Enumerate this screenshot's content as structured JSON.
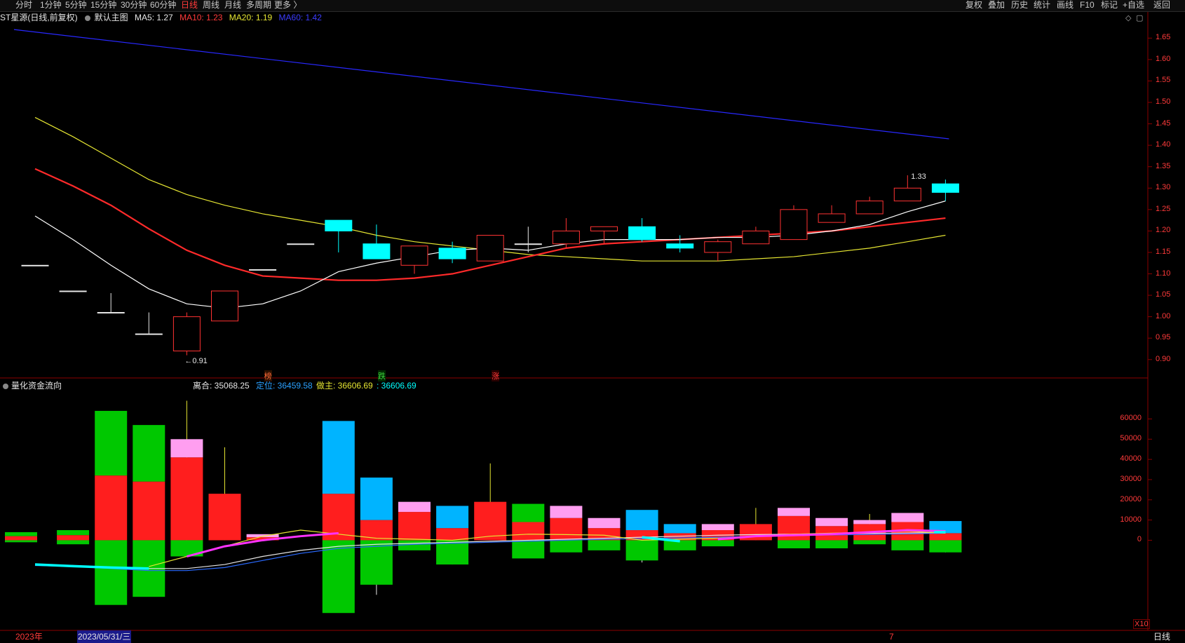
{
  "toolbar": {
    "left_items": [
      "分时",
      "1分钟",
      "5分钟",
      "15分钟",
      "30分钟",
      "60分钟",
      "日线",
      "周线",
      "月线",
      "多周期",
      "更多 〉"
    ],
    "active_index": 6,
    "right_items": [
      "复权",
      "叠加",
      "历史",
      "统计",
      "画线",
      "F10",
      "标记",
      "+自选",
      "返回"
    ]
  },
  "main_header": {
    "stock": "ST星源(日线,前复权)",
    "template": "默认主图",
    "ma5": "MA5: 1.27",
    "ma10": "MA10: 1.23",
    "ma20": "MA20: 1.19",
    "ma60": "MA60: 1.42"
  },
  "sub_header": {
    "indicator": "量化资金流向",
    "v1": "离合: 35068.25",
    "v2": "定位: 36459.58",
    "v3": "做主: 36606.69",
    "v4": ": 36606.69"
  },
  "annotations": {
    "low": "←0.91",
    "high": "1.33",
    "tag1": "榜",
    "tag2": "跌",
    "tag3": "涨"
  },
  "colors": {
    "up": "#ff3232",
    "down": "#00ffff",
    "ma5": "#ffffff",
    "ma10": "#ff2a2a",
    "ma20": "#e6e632",
    "ma60": "#2828ff",
    "axis": "#8b0000"
  },
  "chart_data": [
    {
      "type": "candlestick",
      "title": "ST星源(日线,前复权)",
      "y_ticks": [
        "1.65",
        "1.60",
        "1.55",
        "1.50",
        "1.45",
        "1.40",
        "1.35",
        "1.30",
        "1.25",
        "1.20",
        "1.15",
        "1.10",
        "1.05",
        "1.00",
        "0.95",
        "0.90"
      ],
      "ylim": [
        0.88,
        1.68
      ],
      "candles": [
        {
          "o": 1.12,
          "h": 1.12,
          "l": 1.12,
          "c": 1.12
        },
        {
          "o": 1.06,
          "h": 1.06,
          "l": 1.06,
          "c": 1.06
        },
        {
          "o": 1.01,
          "h": 1.055,
          "l": 1.01,
          "c": 1.01
        },
        {
          "o": 0.96,
          "h": 1.01,
          "l": 0.96,
          "c": 0.96
        },
        {
          "o": 0.92,
          "h": 1.01,
          "l": 0.91,
          "c": 1.0
        },
        {
          "o": 0.99,
          "h": 1.06,
          "l": 0.99,
          "c": 1.06
        },
        {
          "o": 1.11,
          "h": 1.11,
          "l": 1.11,
          "c": 1.11
        },
        {
          "o": 1.17,
          "h": 1.17,
          "l": 1.17,
          "c": 1.17
        },
        {
          "o": 1.225,
          "h": 1.225,
          "l": 1.15,
          "c": 1.2
        },
        {
          "o": 1.17,
          "h": 1.215,
          "l": 1.14,
          "c": 1.135
        },
        {
          "o": 1.12,
          "h": 1.165,
          "l": 1.1,
          "c": 1.165
        },
        {
          "o": 1.16,
          "h": 1.175,
          "l": 1.125,
          "c": 1.135
        },
        {
          "o": 1.13,
          "h": 1.19,
          "l": 1.13,
          "c": 1.19
        },
        {
          "o": 1.17,
          "h": 1.21,
          "l": 1.15,
          "c": 1.17
        },
        {
          "o": 1.17,
          "h": 1.23,
          "l": 1.16,
          "c": 1.2
        },
        {
          "o": 1.2,
          "h": 1.21,
          "l": 1.17,
          "c": 1.21
        },
        {
          "o": 1.21,
          "h": 1.23,
          "l": 1.175,
          "c": 1.18
        },
        {
          "o": 1.17,
          "h": 1.19,
          "l": 1.15,
          "c": 1.16
        },
        {
          "o": 1.15,
          "h": 1.18,
          "l": 1.13,
          "c": 1.175
        },
        {
          "o": 1.17,
          "h": 1.21,
          "l": 1.17,
          "c": 1.2
        },
        {
          "o": 1.18,
          "h": 1.26,
          "l": 1.18,
          "c": 1.25
        },
        {
          "o": 1.22,
          "h": 1.26,
          "l": 1.22,
          "c": 1.24
        },
        {
          "o": 1.24,
          "h": 1.28,
          "l": 1.24,
          "c": 1.27
        },
        {
          "o": 1.27,
          "h": 1.33,
          "l": 1.27,
          "c": 1.3
        },
        {
          "o": 1.31,
          "h": 1.32,
          "l": 1.27,
          "c": 1.29
        }
      ],
      "ma5": [
        1.235,
        1.18,
        1.12,
        1.065,
        1.03,
        1.02,
        1.03,
        1.06,
        1.105,
        1.125,
        1.14,
        1.155,
        1.16,
        1.155,
        1.17,
        1.18,
        1.18,
        1.18,
        1.185,
        1.185,
        1.19,
        1.2,
        1.215,
        1.245,
        1.27
      ],
      "ma10": [
        1.345,
        1.305,
        1.26,
        1.205,
        1.155,
        1.12,
        1.095,
        1.09,
        1.085,
        1.085,
        1.09,
        1.1,
        1.12,
        1.14,
        1.16,
        1.17,
        1.175,
        1.18,
        1.185,
        1.19,
        1.195,
        1.2,
        1.21,
        1.22,
        1.23
      ],
      "ma20": [
        1.465,
        1.42,
        1.37,
        1.32,
        1.285,
        1.26,
        1.24,
        1.225,
        1.21,
        1.19,
        1.175,
        1.165,
        1.155,
        1.145,
        1.14,
        1.135,
        1.13,
        1.13,
        1.13,
        1.135,
        1.14,
        1.15,
        1.16,
        1.175,
        1.19
      ],
      "ma60_start": 1.67,
      "ma60_end": 1.415
    },
    {
      "type": "bar",
      "title": "量化资金流向",
      "y_ticks": [
        "60000",
        "50000",
        "40000",
        "30000",
        "20000",
        "10000",
        "0"
      ],
      "ylim": [
        -38000,
        73000
      ],
      "multiplier_label": "X10",
      "bars": [
        {
          "pos": [
            4000,
            2000
          ],
          "neg": [
            -1000,
            -3000
          ],
          "pink": 0,
          "blue": 0,
          "wick": 0
        },
        {
          "pos": [
            5000,
            2500
          ],
          "neg": [
            -2000,
            -3000
          ],
          "pink": 0,
          "blue": 0,
          "wick": 0
        },
        {
          "pos": [
            64000,
            32000
          ],
          "neg": [
            -32000,
            -32000
          ],
          "pink": 0,
          "blue": 0,
          "wick": 0
        },
        {
          "pos": [
            57000,
            29000
          ],
          "neg": [
            -28000,
            -28000
          ],
          "pink": 0,
          "blue": 0,
          "wick": 0
        },
        {
          "pos": [
            41000,
            41000
          ],
          "neg": [
            -8000,
            -8000
          ],
          "pink": 9000,
          "blue": 0,
          "wick": 69000
        },
        {
          "pos": [
            23000,
            23000
          ],
          "neg": [
            0,
            0
          ],
          "pink": 0,
          "blue": 0,
          "wick": 46000
        },
        {
          "pos": [
            1500,
            1500
          ],
          "neg": [
            0,
            0
          ],
          "pink": 1500,
          "blue": 0,
          "wick": 0
        },
        {
          "pos": [
            0,
            0
          ],
          "neg": [
            0,
            0
          ],
          "pink": 0,
          "blue": 0,
          "wick": 0
        },
        {
          "pos": [
            23000,
            23000
          ],
          "neg": [
            -36000,
            -36000
          ],
          "pink": 0,
          "blue": 36000,
          "wick": -31000
        },
        {
          "pos": [
            10000,
            10000
          ],
          "neg": [
            -22000,
            -22000
          ],
          "pink": 0,
          "blue": 21000,
          "wick": -27000
        },
        {
          "pos": [
            14000,
            14000
          ],
          "neg": [
            -5000,
            -5000
          ],
          "pink": 5000,
          "blue": 0,
          "wick": 0
        },
        {
          "pos": [
            6000,
            6000
          ],
          "neg": [
            -12000,
            -12000
          ],
          "pink": 0,
          "blue": 11000,
          "wick": -12000
        },
        {
          "pos": [
            19000,
            19000
          ],
          "neg": [
            0,
            0
          ],
          "pink": 0,
          "blue": 0,
          "wick": 38000
        },
        {
          "pos": [
            18000,
            9000
          ],
          "neg": [
            -9000,
            -9000
          ],
          "pink": 0,
          "blue": 0,
          "wick": 0
        },
        {
          "pos": [
            11000,
            11000
          ],
          "neg": [
            -6000,
            -6000
          ],
          "pink": 6000,
          "blue": 0,
          "wick": 0
        },
        {
          "pos": [
            6000,
            6000
          ],
          "neg": [
            -5000,
            -5000
          ],
          "pink": 5000,
          "blue": 0,
          "wick": 0
        },
        {
          "pos": [
            5000,
            5000
          ],
          "neg": [
            -10000,
            -10000
          ],
          "pink": 0,
          "blue": 10000,
          "wick": -11000
        },
        {
          "pos": [
            3500,
            3500
          ],
          "neg": [
            -5000,
            -5000
          ],
          "pink": 0,
          "blue": 4500,
          "wick": 0
        },
        {
          "pos": [
            5000,
            5000
          ],
          "neg": [
            -3000,
            -3000
          ],
          "pink": 3000,
          "blue": 0,
          "wick": 0
        },
        {
          "pos": [
            8000,
            8000
          ],
          "neg": [
            0,
            0
          ],
          "pink": 0,
          "blue": 0,
          "wick": 16000
        },
        {
          "pos": [
            12000,
            12000
          ],
          "neg": [
            -4000,
            -4000
          ],
          "pink": 4000,
          "blue": 0,
          "wick": 0
        },
        {
          "pos": [
            7000,
            7000
          ],
          "neg": [
            -4000,
            -4000
          ],
          "pink": 4000,
          "blue": 0,
          "wick": 0
        },
        {
          "pos": [
            8000,
            8000
          ],
          "neg": [
            -2000,
            -2000
          ],
          "pink": 2000,
          "blue": 0,
          "wick": 13000
        },
        {
          "pos": [
            9000,
            9000
          ],
          "neg": [
            -5000,
            -5000
          ],
          "pink": 4500,
          "blue": 0,
          "wick": 0
        },
        {
          "pos": [
            3500,
            3500
          ],
          "neg": [
            -6000,
            -6000
          ],
          "pink": 0,
          "blue": 6000,
          "wick": -6000
        }
      ],
      "line_white": [
        -12000,
        -12500,
        -13500,
        -14000,
        -14000,
        -12000,
        -8000,
        -5000,
        -3000,
        -2000,
        -1500,
        -1000,
        -500,
        0,
        500,
        1000,
        1500,
        2000,
        2500,
        2800,
        3000,
        3200,
        3400,
        3600,
        3800
      ],
      "line_blue": [
        -12500,
        -13000,
        -14000,
        -15000,
        -15000,
        -13500,
        -10000,
        -6500,
        -4000,
        -3000,
        -2000,
        -1500,
        -1000,
        -500,
        0,
        500,
        800,
        1200,
        1500,
        2000,
        2300,
        2600,
        2900,
        3200,
        3500
      ],
      "line_yellow": [
        null,
        null,
        null,
        -13000,
        -8000,
        -3000,
        2000,
        5000,
        3000,
        1000,
        500,
        0,
        2000,
        3000,
        2800,
        2500,
        0,
        500,
        1000,
        2000,
        3000,
        3500,
        4000,
        4500,
        3500
      ],
      "line_magenta_segments": [
        [
          [
            4,
            -8000
          ],
          [
            5,
            -3000
          ],
          [
            6,
            0
          ],
          [
            7,
            2000
          ],
          [
            8,
            3500
          ]
        ],
        [
          [
            18,
            500
          ],
          [
            19,
            2000
          ],
          [
            20,
            2500
          ],
          [
            21,
            3000
          ],
          [
            22,
            4000
          ],
          [
            23,
            5000
          ],
          [
            24,
            4500
          ]
        ]
      ],
      "line_cyan_segments": [
        [
          [
            0,
            -12000
          ],
          [
            1,
            -12800
          ],
          [
            2,
            -13500
          ],
          [
            3,
            -14000
          ]
        ],
        [
          [
            16,
            1500
          ],
          [
            17,
            -500
          ]
        ],
        [
          [
            24,
            4000
          ]
        ]
      ]
    }
  ],
  "bottom": {
    "year_label": "2023年",
    "date_label": "2023/05/31/三",
    "tick_7": "7",
    "period": "日线"
  }
}
